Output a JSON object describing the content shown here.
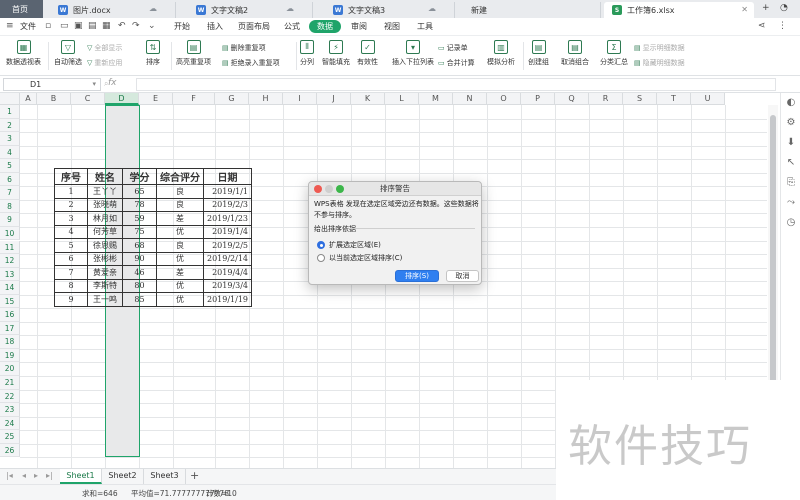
{
  "tabs": {
    "home": "首页",
    "files": [
      {
        "label": "图片.docx",
        "type": "W"
      },
      {
        "label": "文字文稿2",
        "type": "W"
      },
      {
        "label": "文字文稿3",
        "type": "W"
      },
      {
        "label": "新建",
        "type": ""
      },
      {
        "label": "工作簿6.xlsx",
        "type": "S"
      }
    ]
  },
  "menubar": {
    "file": "文件",
    "items": [
      "开始",
      "插入",
      "页面布局",
      "公式",
      "数据",
      "审阅",
      "视图",
      "工具"
    ],
    "active": "数据"
  },
  "ribbon": {
    "pivot": "数据透视表",
    "autofilter": "自动筛选",
    "show_all": "全部显示",
    "reapply": "重新应用",
    "sort": "排序",
    "highlight_dup": "高亮重复项",
    "delete_dup": "删除重复项",
    "reject_dup": "拒绝录入重复项",
    "split": "分列",
    "smart_fill": "智能填充",
    "validity": "有效性",
    "dropdown_list": "插入下拉列表",
    "record": "记录单",
    "consolidate": "合并计算",
    "simulate": "模拟分析",
    "create_group": "创建组",
    "ungroup": "取消组合",
    "subtotal": "分类汇总",
    "show_detail": "显示明细数据",
    "hide_detail": "隐藏明细数据"
  },
  "formula_bar": {
    "cell_ref": "D1",
    "fx": "fx"
  },
  "grid": {
    "columns": [
      "A",
      "B",
      "C",
      "D",
      "E",
      "F",
      "G",
      "H",
      "I",
      "J",
      "K",
      "L",
      "M",
      "N",
      "O",
      "P",
      "Q",
      "R",
      "S",
      "T",
      "U"
    ],
    "selected_column": "D",
    "row_count": 26
  },
  "table": {
    "headers": [
      "序号",
      "姓名",
      "学分",
      "综合评分",
      "日期"
    ],
    "rows": [
      [
        "1",
        "王丫丫",
        "65",
        "良",
        "2019/1/1"
      ],
      [
        "2",
        "张晓萌",
        "78",
        "良",
        "2019/2/3"
      ],
      [
        "3",
        "林月如",
        "59",
        "差",
        "2019/1/23"
      ],
      [
        "4",
        "何芳草",
        "75",
        "优",
        "2019/1/4"
      ],
      [
        "5",
        "徐恩赐",
        "68",
        "良",
        "2019/2/5"
      ],
      [
        "6",
        "张彬彬",
        "90",
        "优",
        "2019/2/14"
      ],
      [
        "7",
        "黄爱亲",
        "46",
        "差",
        "2019/4/4"
      ],
      [
        "8",
        "李斯特",
        "80",
        "优",
        "2019/3/4"
      ],
      [
        "9",
        "王一鸣",
        "85",
        "优",
        "2019/1/19"
      ]
    ]
  },
  "dialog": {
    "title": "排序警告",
    "message": "WPS表格 发现在选定区域旁边还有数据。这些数据将不参与排序。",
    "basis_label": "给出排序依据",
    "option_expand": "扩展选定区域(E)",
    "option_current": "以当前选定区域排序(C)",
    "selected_option": "expand",
    "ok": "排序(S)",
    "cancel": "取消"
  },
  "sheets": {
    "tabs": [
      "Sheet1",
      "Sheet2",
      "Sheet3"
    ],
    "active": "Sheet1",
    "add": "+"
  },
  "status": {
    "sum": "求和=646",
    "avg": "平均值=71.777777777778",
    "count": "计数=10"
  },
  "watermark": "软件技巧",
  "colors": {
    "accent": "#1fa46a",
    "dialog_primary": "#2f7ff0",
    "home_tab": "#5a6471"
  }
}
